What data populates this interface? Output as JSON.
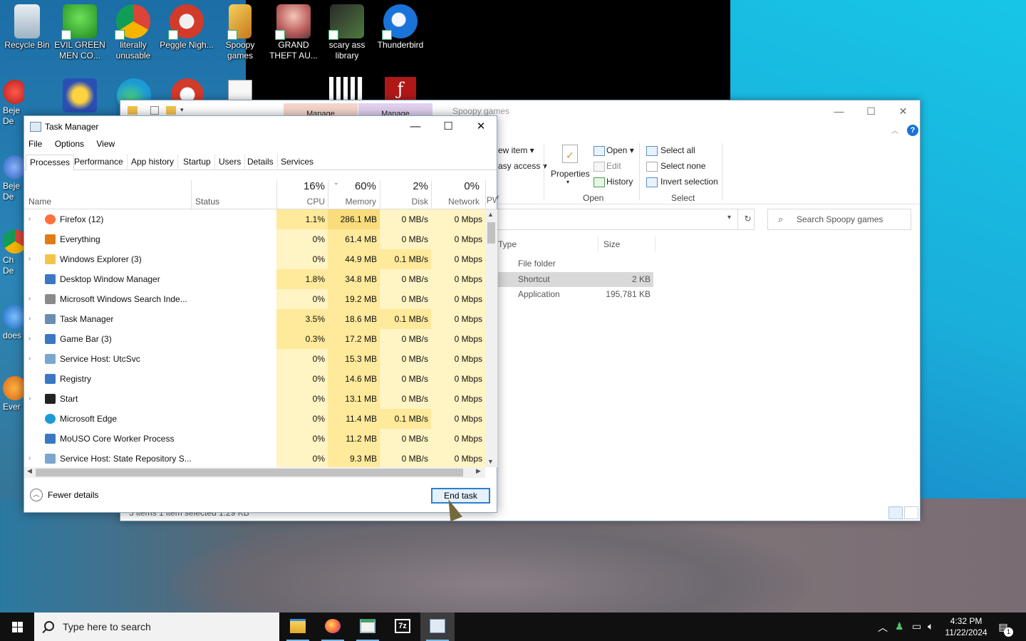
{
  "desktop": {
    "icons": [
      {
        "label": "Recycle Bin"
      },
      {
        "label": "EVIL GREEN MEN CO..."
      },
      {
        "label": "literally unusable"
      },
      {
        "label": "Peggle Nigh..."
      },
      {
        "label": "Spoopy games"
      },
      {
        "label": "GRAND THEFT AU..."
      },
      {
        "label": "scary ass library"
      },
      {
        "label": "Thunderbird"
      }
    ],
    "side_icons": [
      {
        "label": "Beje De"
      },
      {
        "label": "Beje De"
      },
      {
        "label": "Ch De"
      },
      {
        "label": "does"
      },
      {
        "label": "Ever"
      }
    ]
  },
  "explorer": {
    "title": "Spoopy games",
    "manage_tabs": [
      "Manage",
      "Manage"
    ],
    "ribbon": {
      "new_item": "ew item",
      "easy_access": "asy access",
      "properties": "Properties",
      "open": "Open",
      "edit": "Edit",
      "history": "History",
      "open_group": "Open",
      "select_all": "Select all",
      "select_none": "Select none",
      "invert_selection": "Invert selection",
      "select_group": "Select"
    },
    "search_placeholder": "Search Spoopy games",
    "columns": {
      "type": "Type",
      "size": "Size"
    },
    "rows": [
      {
        "type": "File folder",
        "size": ""
      },
      {
        "type": "Shortcut",
        "size": "2 KB"
      },
      {
        "type": "Application",
        "size": "195,781 KB"
      }
    ],
    "status": "3 items    1 item selected  1.29 KB"
  },
  "taskmgr": {
    "title": "Task Manager",
    "menu": [
      "File",
      "Options",
      "View"
    ],
    "tabs": [
      "Processes",
      "Performance",
      "App history",
      "Startup",
      "Users",
      "Details",
      "Services"
    ],
    "active_tab": "Processes",
    "headers": {
      "name": "Name",
      "status": "Status",
      "cpu_pct": "16%",
      "cpu": "CPU",
      "mem_pct": "60%",
      "mem": "Memory",
      "disk_pct": "2%",
      "disk": "Disk",
      "net_pct": "0%",
      "net": "Network",
      "extra": "PW"
    },
    "processes": [
      {
        "name": "Firefox (12)",
        "expand": true,
        "cpu": "1.1%",
        "mem": "286.1 MB",
        "disk": "0 MB/s",
        "net": "0 Mbps",
        "icon": "firefox-icon",
        "color": "#ff7139"
      },
      {
        "name": "Everything",
        "expand": false,
        "cpu": "0%",
        "mem": "61.4 MB",
        "disk": "0 MB/s",
        "net": "0 Mbps",
        "icon": "search-orange-icon",
        "color": "#e07b16"
      },
      {
        "name": "Windows Explorer (3)",
        "expand": true,
        "cpu": "0%",
        "mem": "44.9 MB",
        "disk": "0.1 MB/s",
        "net": "0 Mbps",
        "icon": "folder-icon",
        "color": "#f2c44b"
      },
      {
        "name": "Desktop Window Manager",
        "expand": false,
        "cpu": "1.8%",
        "mem": "34.8 MB",
        "disk": "0 MB/s",
        "net": "0 Mbps",
        "icon": "window-icon",
        "color": "#3b78c3"
      },
      {
        "name": "Microsoft Windows Search Inde...",
        "expand": true,
        "cpu": "0%",
        "mem": "19.2 MB",
        "disk": "0 MB/s",
        "net": "0 Mbps",
        "icon": "search-indexer-icon",
        "color": "#8a8a8a"
      },
      {
        "name": "Task Manager",
        "expand": true,
        "cpu": "3.5%",
        "mem": "18.6 MB",
        "disk": "0.1 MB/s",
        "net": "0 Mbps",
        "icon": "task-manager-icon",
        "color": "#6b8db0"
      },
      {
        "name": "Game Bar (3)",
        "expand": true,
        "cpu": "0.3%",
        "mem": "17.2 MB",
        "disk": "0 MB/s",
        "net": "0 Mbps",
        "icon": "window-icon",
        "color": "#3b78c3"
      },
      {
        "name": "Service Host: UtcSvc",
        "expand": true,
        "cpu": "0%",
        "mem": "15.3 MB",
        "disk": "0 MB/s",
        "net": "0 Mbps",
        "icon": "gear-icon",
        "color": "#7aa6cf"
      },
      {
        "name": "Registry",
        "expand": false,
        "cpu": "0%",
        "mem": "14.6 MB",
        "disk": "0 MB/s",
        "net": "0 Mbps",
        "icon": "window-icon",
        "color": "#3b78c3"
      },
      {
        "name": "Start",
        "expand": true,
        "cpu": "0%",
        "mem": "13.1 MB",
        "disk": "0 MB/s",
        "net": "0 Mbps",
        "icon": "start-icon",
        "color": "#222222"
      },
      {
        "name": "Microsoft Edge",
        "expand": false,
        "cpu": "0%",
        "mem": "11.4 MB",
        "disk": "0.1 MB/s",
        "net": "0 Mbps",
        "icon": "edge-icon",
        "color": "#1c9ad6"
      },
      {
        "name": "MoUSO Core Worker Process",
        "expand": false,
        "cpu": "0%",
        "mem": "11.2 MB",
        "disk": "0 MB/s",
        "net": "0 Mbps",
        "icon": "window-icon",
        "color": "#3b78c3"
      },
      {
        "name": "Service Host: State Repository S...",
        "expand": true,
        "cpu": "0%",
        "mem": "9.3 MB",
        "disk": "0 MB/s",
        "net": "0 Mbps",
        "icon": "gear-icon",
        "color": "#7aa6cf"
      }
    ],
    "fewer_details": "Fewer details",
    "end_task": "End task"
  },
  "taskbar": {
    "search_placeholder": "Type here to search",
    "apps": [
      "file-explorer-icon",
      "firefox-icon",
      "notepad-icon",
      "7zip-icon",
      "task-manager-icon"
    ],
    "time": "4:32 PM",
    "date": "11/22/2024",
    "notification_count": "1"
  },
  "colors": {
    "heat_light": "#fff4c4",
    "heat_mid": "#ffe99a",
    "heat_strong": "#f9dc7b",
    "accent": "#2c7fd1"
  }
}
